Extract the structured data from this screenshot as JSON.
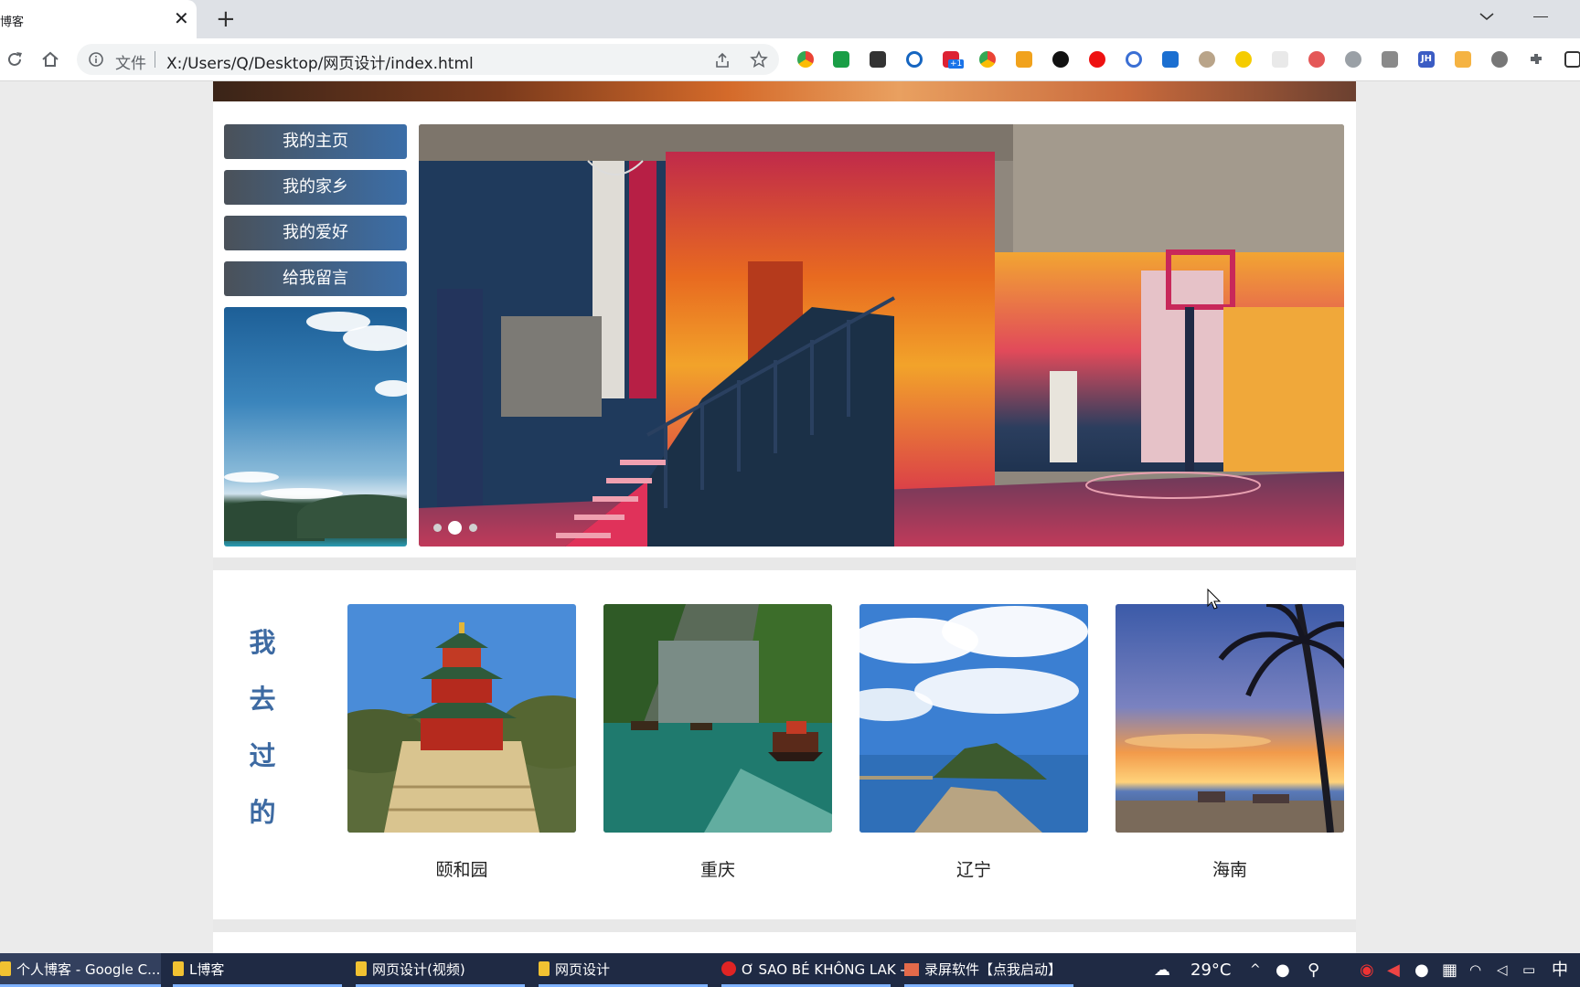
{
  "browser": {
    "tab_title": "博客",
    "url_prefix": "文件",
    "url": "X:/Users/Q/Desktop/网页设计/index.html",
    "extension_badge": "+1",
    "extension_jh": "JH"
  },
  "sidebar": {
    "items": [
      {
        "label": "我的主页"
      },
      {
        "label": "我的家乡"
      },
      {
        "label": "我的爱好"
      },
      {
        "label": "给我留言"
      }
    ]
  },
  "slider": {
    "slide_count": 3,
    "active_index": 1
  },
  "visited": {
    "title_chars": [
      "我",
      "去",
      "过",
      "的"
    ],
    "places": [
      {
        "name": "颐和园"
      },
      {
        "name": "重庆"
      },
      {
        "name": "辽宁"
      },
      {
        "name": "海南"
      }
    ]
  },
  "taskbar": {
    "items": [
      {
        "label": "个人博客 - Google C..."
      },
      {
        "label": "L博客"
      },
      {
        "label": "网页设计(视频)"
      },
      {
        "label": "网页设计"
      },
      {
        "label": "Ơ SAO BÉ KHÔNG LAK -..."
      },
      {
        "label": "录屏软件【点我启动】"
      }
    ],
    "weather_temp": "29°C",
    "ime": "中"
  },
  "colors": {
    "nav_start": "#4a5159",
    "nav_end": "#3b6ea8",
    "title_blue": "#3d6aa2",
    "taskbar": "#1f2a44"
  }
}
